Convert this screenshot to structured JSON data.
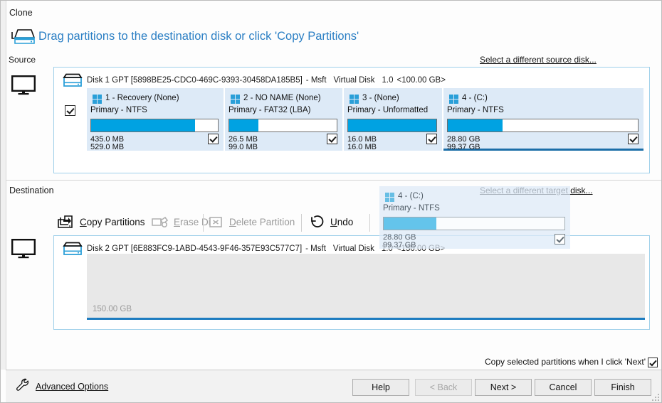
{
  "window": {
    "page_label": "Clone"
  },
  "header": {
    "title": "Drag partitions to the destination disk or click 'Copy Partitions'",
    "icon": "disk-drive-icon",
    "accent_color": "#2b7fc4"
  },
  "source": {
    "caption": "Source",
    "computer_icon": "monitor-icon",
    "change_link": "Select a different source disk...",
    "disk": {
      "icon": "hard-disk-icon",
      "checkbox_checked": true,
      "name": "Disk 1 GPT [5898BE25-CDC0-469C-9393-30458DA185B5]",
      "vendor": "- Msft",
      "model": "Virtual Disk",
      "revision": "1.0",
      "capacity": "<100.00 GB>"
    },
    "partitions": [
      {
        "logo": "windows-logo-icon",
        "title": "1 - Recovery (None)",
        "subtitle": "Primary - NTFS",
        "used_label": "435.0 MB",
        "total_label": "529.0 MB",
        "used_pct": 82,
        "checked": true,
        "selected": false
      },
      {
        "logo": "windows-logo-icon",
        "title": "2 - NO NAME (None)",
        "subtitle": "Primary - FAT32 (LBA)",
        "used_label": "26.5 MB",
        "total_label": "99.0 MB",
        "used_pct": 27,
        "checked": true,
        "selected": false
      },
      {
        "logo": "windows-logo-icon",
        "title": "3 -  (None)",
        "subtitle": "Primary - Unformatted",
        "used_label": "16.0 MB",
        "total_label": "16.0 MB",
        "used_pct": 100,
        "checked": true,
        "selected": false
      },
      {
        "logo": "windows-logo-icon",
        "title": "4 -  (C:)",
        "subtitle": "Primary - NTFS",
        "used_label": "28.80 GB",
        "total_label": "99.37 GB",
        "used_pct": 29,
        "checked": true,
        "selected": true
      }
    ]
  },
  "destination": {
    "caption": "Destination",
    "computer_icon": "monitor-icon",
    "change_link": "Select a different target disk...",
    "toolbar": [
      {
        "label": "Copy Partitions",
        "icon": "copy-partitions-icon",
        "enabled": true,
        "accesskey": "C"
      },
      {
        "label": "Erase Disk",
        "icon": "erase-disk-icon",
        "enabled": false,
        "accesskey": "E"
      },
      {
        "label": "Delete Partition",
        "icon": "delete-partition-icon",
        "enabled": false,
        "accesskey": "D"
      },
      {
        "label": "Undo",
        "icon": "undo-icon",
        "enabled": true,
        "accesskey": "U"
      }
    ],
    "disk": {
      "icon": "hard-disk-icon",
      "name": "Disk 2 GPT [6E883FC9-1ABD-4543-9F46-357E93C577C7]",
      "vendor": "- Msft",
      "model": "Virtual Disk",
      "revision": "1.0",
      "capacity": "<150.00 GB>",
      "free_space_label": "150.00 GB"
    }
  },
  "drag_ghost": {
    "logo": "windows-logo-icon",
    "title": "4 -  (C:)",
    "subtitle": "Primary - NTFS",
    "used_label": "28.80 GB",
    "total_label": "99.37 GB",
    "used_pct": 29,
    "checked": true
  },
  "footer": {
    "note": "Copy selected partitions when I click 'Next'",
    "note_checked": true,
    "advanced_options": "Advanced Options",
    "advanced_icon": "wrench-icon",
    "buttons": [
      {
        "id": "help",
        "label": "Help",
        "enabled": true
      },
      {
        "id": "back",
        "label": "< Back",
        "enabled": false
      },
      {
        "id": "next",
        "label": "Next >",
        "enabled": true
      },
      {
        "id": "cancel",
        "label": "Cancel",
        "enabled": true
      },
      {
        "id": "finish",
        "label": "Finish",
        "enabled": true
      }
    ]
  }
}
